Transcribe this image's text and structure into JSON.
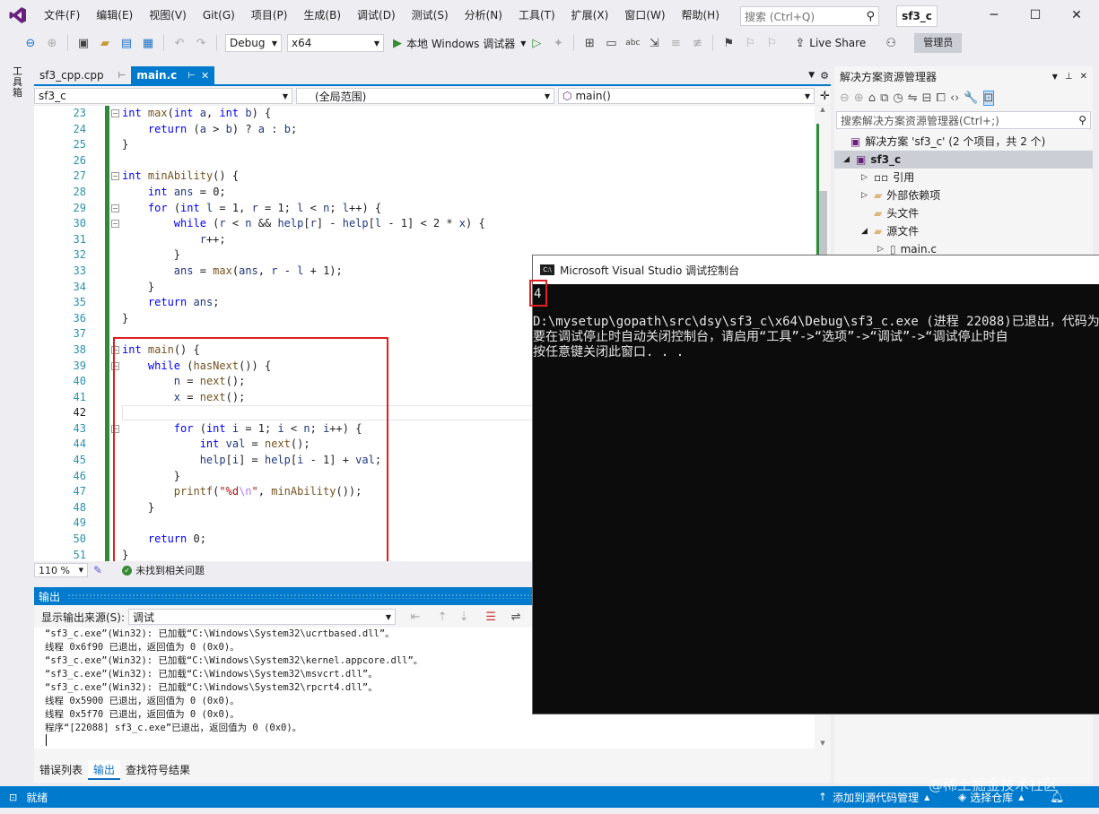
{
  "menu": {
    "items": [
      "文件(F)",
      "编辑(E)",
      "视图(V)",
      "Git(G)",
      "项目(P)",
      "生成(B)",
      "调试(D)",
      "测试(S)",
      "分析(N)",
      "工具(T)",
      "扩展(X)",
      "窗口(W)",
      "帮助(H)"
    ],
    "search_placeholder": "搜索 (Ctrl+Q)",
    "solution_badge": "sf3_c"
  },
  "toolbar": {
    "config": "Debug",
    "platform": "x64",
    "run_label": "本地 Windows 调试器",
    "live_share": "Live Share",
    "admin": "管理员"
  },
  "left_strip": {
    "label": "工具箱"
  },
  "editor": {
    "tabs": [
      {
        "label": "sf3_cpp.cpp",
        "active": false
      },
      {
        "label": "main.c",
        "active": true
      }
    ],
    "nav": {
      "project": "sf3_c",
      "scope": "(全局范围)",
      "member": "main()"
    },
    "line_numbers": [
      "23",
      "24",
      "25",
      "26",
      "27",
      "28",
      "29",
      "30",
      "31",
      "32",
      "33",
      "34",
      "35",
      "36",
      "37",
      "38",
      "39",
      "40",
      "41",
      "42",
      "43",
      "44",
      "45",
      "46",
      "47",
      "48",
      "49",
      "50",
      "51"
    ],
    "zoom": "110 %",
    "status": "未找到相关问题"
  },
  "output": {
    "title": "输出",
    "source_label": "显示输出来源(S):",
    "source_value": "调试",
    "lines": [
      "“sf3_c.exe”(Win32): 已加载“C:\\Windows\\System32\\ucrtbased.dll”。",
      "线程 0x6f90 已退出，返回值为 0 (0x0)。",
      "“sf3_c.exe”(Win32): 已加载“C:\\Windows\\System32\\kernel.appcore.dll”。",
      "“sf3_c.exe”(Win32): 已加载“C:\\Windows\\System32\\msvcrt.dll”。",
      "“sf3_c.exe”(Win32): 已加载“C:\\Windows\\System32\\rpcrt4.dll”。",
      "线程 0x5900 已退出，返回值为 0 (0x0)。",
      "线程 0x5f70 已退出，返回值为 0 (0x0)。",
      "程序“[22088] sf3_c.exe”已退出，返回值为 0 (0x0)。"
    ],
    "tabs": [
      "错误列表",
      "输出",
      "查找符号结果"
    ]
  },
  "solution_explorer": {
    "title": "解决方案资源管理器",
    "search_placeholder": "搜索解决方案资源管理器(Ctrl+;)",
    "solution_line": "解决方案 'sf3_c' (2 个项目，共 2 个)",
    "project": "sf3_c",
    "items": [
      "引用",
      "外部依赖项",
      "头文件",
      "源文件",
      "main.c"
    ]
  },
  "console": {
    "title": "Microsoft Visual Studio 调试控制台",
    "output_value": "4",
    "lines": [
      "D:\\mysetup\\gopath\\src\\dsy\\sf3_c\\x64\\Debug\\sf3_c.exe (进程 22088)已退出，代码为",
      "要在调试停止时自动关闭控制台，请启用“工具”->“选项”->“调试”->“调试停止时自",
      "按任意键关闭此窗口. . ."
    ]
  },
  "statusbar": {
    "ready": "就绪",
    "add_source": "添加到源代码管理",
    "select_repo": "选择仓库"
  },
  "watermark": {
    "text": "@稀土掘金技术社区"
  },
  "colors": {
    "accent": "#007acc",
    "highlight_box": "#e02020",
    "console_bg": "#0c0c0c",
    "vs_purple": "#68217a"
  }
}
